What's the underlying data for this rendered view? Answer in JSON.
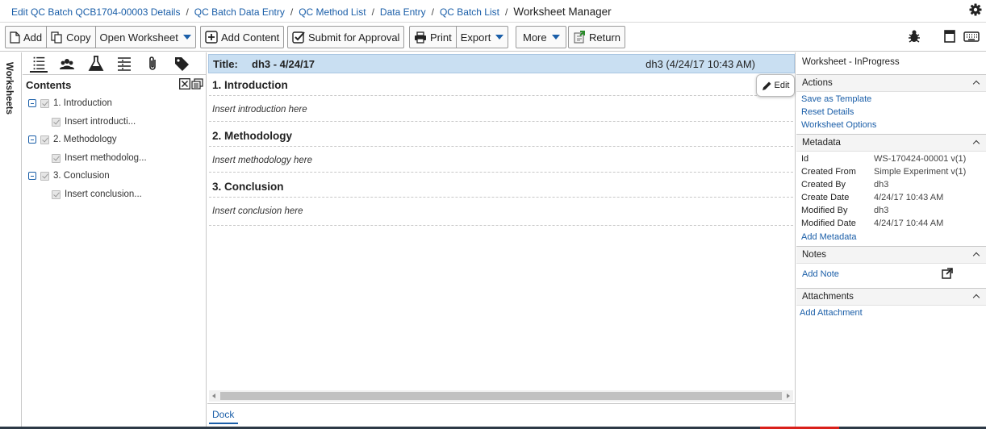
{
  "breadcrumb": {
    "items": [
      "Edit QC Batch QCB1704-00003 Details",
      "QC Batch Data Entry",
      "QC Method List",
      "Data Entry",
      "QC Batch List"
    ],
    "separator": "/",
    "current": "Worksheet Manager"
  },
  "toolbar": {
    "add": "Add",
    "copy": "Copy",
    "open_worksheet": "Open Worksheet",
    "add_content": "Add Content",
    "submit": "Submit for Approval",
    "print": "Print",
    "export": "Export",
    "more": "More",
    "return": "Return"
  },
  "side_tab": "Worksheets",
  "left_panel": {
    "title": "Contents",
    "tree": [
      {
        "label": "1. Introduction",
        "child": "Insert introducti..."
      },
      {
        "label": "2. Methodology",
        "child": "Insert methodolog..."
      },
      {
        "label": "3. Conclusion",
        "child": "Insert conclusion..."
      }
    ]
  },
  "document": {
    "title_label": "Title:",
    "title": "dh3 - 4/24/17",
    "meta": "dh3 (4/24/17 10:43 AM)",
    "edit": "Edit",
    "sections": [
      {
        "heading": "1.  Introduction",
        "body": "Insert introduction here"
      },
      {
        "heading": "2.  Methodology",
        "body": "Insert methodology here"
      },
      {
        "heading": "3.  Conclusion",
        "body": "Insert conclusion here"
      }
    ],
    "dock": "Dock"
  },
  "right_panel": {
    "status": "Worksheet - InProgress",
    "actions": {
      "title": "Actions",
      "links": [
        "Save as Template",
        "Reset Details",
        "Worksheet Options"
      ]
    },
    "metadata": {
      "title": "Metadata",
      "rows": [
        {
          "key": "Id",
          "value": "WS-170424-00001 v(1)"
        },
        {
          "key": "Created From",
          "value": "Simple Experiment v(1)"
        },
        {
          "key": "Created By",
          "value": "dh3"
        },
        {
          "key": "Create Date",
          "value": "4/24/17 10:43 AM"
        },
        {
          "key": "Modified By",
          "value": "dh3"
        },
        {
          "key": "Modified Date",
          "value": "4/24/17 10:44 AM"
        }
      ],
      "add_link": "Add Metadata"
    },
    "notes": {
      "title": "Notes",
      "add_link": "Add Note"
    },
    "attachments": {
      "title": "Attachments",
      "add_link": "Add Attachment"
    }
  },
  "colors": {
    "link": "#1a5ea8",
    "title_bar": "#c9dff2",
    "bottom_strip": "#2d3946",
    "bottom_accent": "#d9201b"
  }
}
